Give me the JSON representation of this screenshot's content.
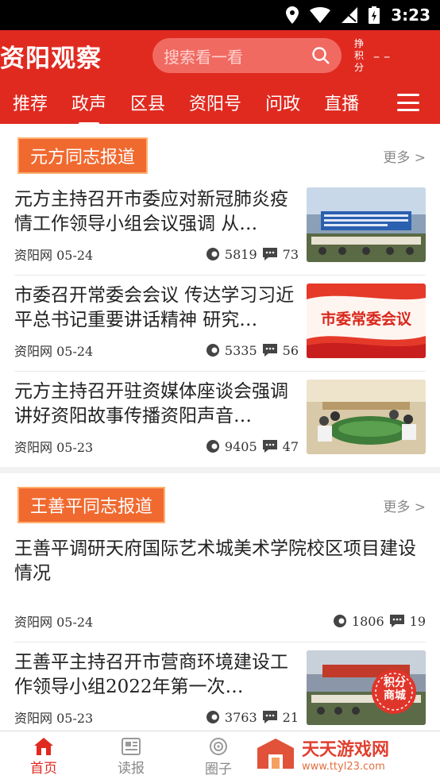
{
  "status": {
    "time": "3:23"
  },
  "header": {
    "logo": "资阳观察",
    "search_placeholder": "搜索看一看",
    "points_label": "挣积分",
    "points_value": "– –"
  },
  "tabs": [
    "推荐",
    "政声",
    "区县",
    "资阳号",
    "问政",
    "直播"
  ],
  "active_tab": "政声",
  "sections": [
    {
      "title": "元方同志报道",
      "more": "更多 >",
      "articles": [
        {
          "title": "元方主持召开市委应对新冠肺炎疫情工作领导小组会议强调 从…",
          "source": "资阳网",
          "date": "05-24",
          "views": "5819",
          "comments": "73"
        },
        {
          "title": "市委召开常委会会议 传达学习习近平总书记重要讲话精神 研究…",
          "source": "资阳网",
          "date": "05-24",
          "views": "5335",
          "comments": "56",
          "thumb_text": "市委常委会议"
        },
        {
          "title": "元方主持召开驻资媒体座谈会强调 讲好资阳故事传播资阳声音…",
          "source": "资阳网",
          "date": "05-23",
          "views": "9405",
          "comments": "47"
        }
      ]
    },
    {
      "title": "王善平同志报道",
      "more": "更多 >",
      "articles": [
        {
          "title": "王善平调研天府国际艺术城美术学院校区项目建设情况",
          "source": "资阳网",
          "date": "05-24",
          "views": "1806",
          "comments": "19"
        },
        {
          "title": "王善平主持召开市营商环境建设工作领导小组2022年第一次…",
          "source": "资阳网",
          "date": "05-23",
          "views": "3763",
          "comments": "21",
          "badge_text": "积分商城"
        }
      ]
    }
  ],
  "bottom_nav": [
    "首页",
    "读报",
    "圈子"
  ],
  "watermark": {
    "name": "天天游戏网",
    "url": "www.ttyl23.com"
  },
  "colors": {
    "brand": "#e02a20",
    "section_tag": "#f06a30"
  }
}
